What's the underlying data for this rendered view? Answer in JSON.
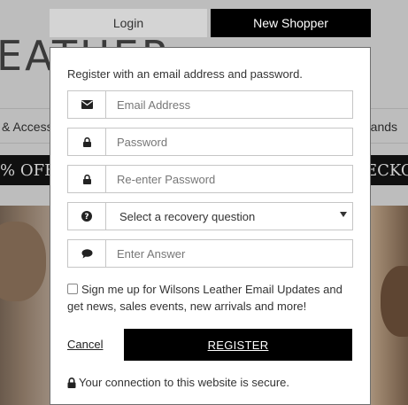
{
  "background": {
    "logo_text": "EATHER",
    "nav_left": "& Access",
    "nav_right": "rands",
    "promo_left": "% OFF",
    "promo_right": "ECKO"
  },
  "tabs": [
    {
      "label": "Login",
      "active": false
    },
    {
      "label": "New Shopper",
      "active": true
    }
  ],
  "form": {
    "intro": "Register with an email address and password.",
    "email_placeholder": "Email Address",
    "password_placeholder": "Password",
    "reenter_placeholder": "Re-enter Password",
    "recovery_question": "Select a recovery question",
    "answer_placeholder": "Enter Answer",
    "newsletter_label": "Sign me up for Wilsons Leather Email Updates and get news, sales events, new arrivals and more!",
    "newsletter_checked": false,
    "cancel_label": "Cancel",
    "register_label": "REGISTER",
    "secure_text": "Your connection to this website is secure."
  },
  "icons": {
    "email": "envelope-icon",
    "password": "lock-icon",
    "reenter": "lock-icon",
    "question": "question-circle-icon",
    "answer": "speech-bubble-icon",
    "secure": "lock-icon"
  },
  "colors": {
    "tab_active_bg": "#000000",
    "tab_inactive_bg": "#d4d4d4",
    "button_bg": "#000000",
    "overlay_bg": "#bdbdbd"
  }
}
